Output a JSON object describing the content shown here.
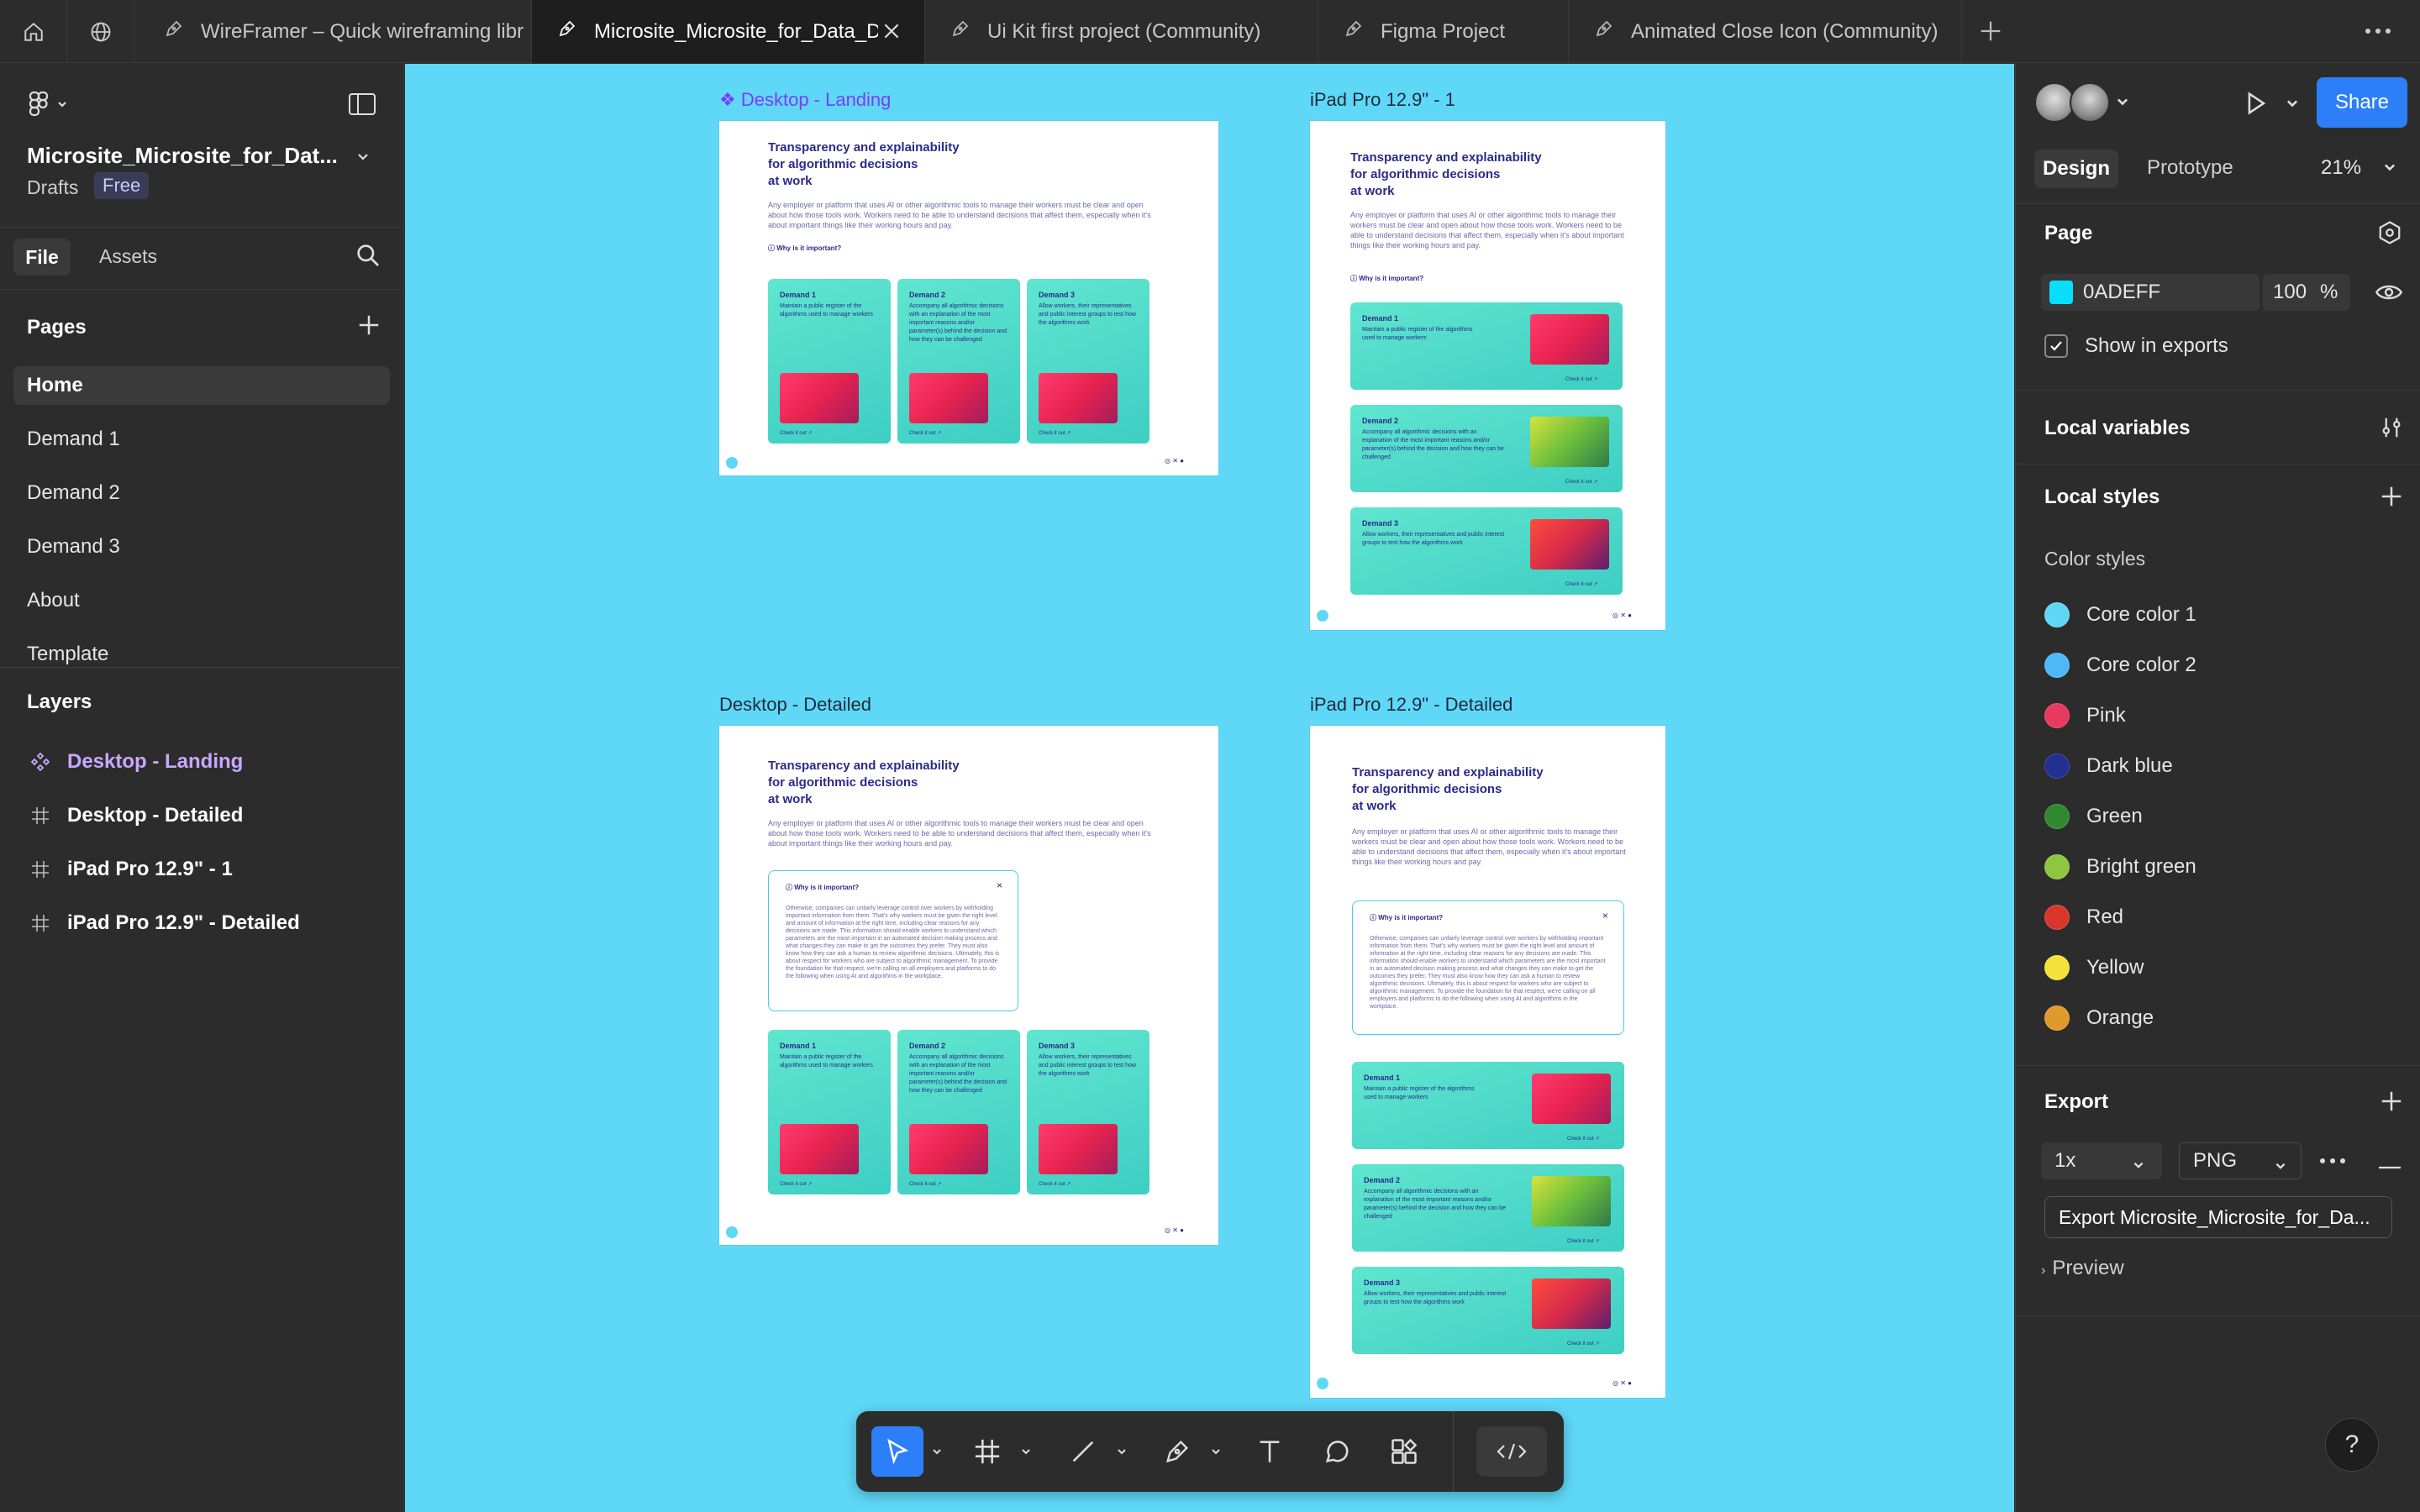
{
  "tabs": [
    {
      "label": "WireFramer – Quick wireframing libr",
      "active": false
    },
    {
      "label": "Microsite_Microsite_for_Data_D",
      "active": true
    },
    {
      "label": "Ui Kit first project (Community)",
      "active": false
    },
    {
      "label": "Figma Project",
      "active": false
    },
    {
      "label": "Animated Close Icon (Community)",
      "active": false
    }
  ],
  "left": {
    "file_name": "Microsite_Microsite_for_Dat...",
    "location": "Drafts",
    "plan_badge": "Free",
    "tab_file": "File",
    "tab_assets": "Assets",
    "pages_heading": "Pages",
    "pages": [
      "Home",
      "Demand 1",
      "Demand 2",
      "Demand 3",
      "About",
      "Template"
    ],
    "layers_heading": "Layers",
    "layers": [
      {
        "label": "Desktop - Landing",
        "type": "component"
      },
      {
        "label": "Desktop - Detailed",
        "type": "frame"
      },
      {
        "label": "iPad Pro 12.9\" - 1",
        "type": "frame"
      },
      {
        "label": "iPad Pro 12.9\" - Detailed",
        "type": "frame"
      }
    ]
  },
  "canvas": {
    "background": "#5fd8f8",
    "frames": [
      {
        "label": "Desktop - Landing",
        "component": true
      },
      {
        "label": "iPad Pro 12.9\" - 1",
        "component": false
      },
      {
        "label": "Desktop - Detailed",
        "component": false
      },
      {
        "label": "iPad Pro 12.9\" - Detailed",
        "component": false
      }
    ],
    "content": {
      "title_line1": "Transparency and explainability",
      "title_line2": "for algorithmic decisions",
      "title_line3": "at work",
      "intro": "Any employer or platform that uses AI or other algorithmic tools to manage their workers must be clear and open about how those tools work. Workers need to be able to understand decisions that affect them, especially when it's about important things like their working hours and pay.",
      "why": "Why is it important?",
      "why_body": "Otherwise, companies can unfairly leverage control over workers by withholding important information from them. That's why workers must be given the right level and amount of information at the right time, including clear reasons for any decisions are made. This information should enable workers to understand which parameters are the most important in an automated decision making process and what changes they can make to get the outcomes they prefer. They must also know how they can ask a human to review algorithmic decisions. Ultimately, this is about respect for workers who are subject to algorithmic management. To provide the foundation for that respect, we're calling on all employers and platforms to do the following when using AI and algorithms in the workplace.",
      "demand1_title": "Demand 1",
      "demand1_body": "Maintain a public register of the algorithms used to manage workers",
      "demand2_title": "Demand 2",
      "demand2_body": "Accompany all algorithmic decisions with an explanation of the most important reasons and/or parameter(s) behind the decision and how they can be challenged",
      "demand3_title": "Demand 3",
      "demand3_body": "Allow workers, their representatives and public interest groups to test how the algorithms work",
      "check": "Check it out ↗"
    }
  },
  "right": {
    "tab_design": "Design",
    "tab_prototype": "Prototype",
    "zoom": "21%",
    "share_label": "Share",
    "page_heading": "Page",
    "page_color": "0ADEFF",
    "page_color_swatch": "#0ADEFF",
    "page_opacity": "100",
    "percent_sign": "%",
    "show_in_exports": "Show in exports",
    "local_variables": "Local variables",
    "local_styles": "Local styles",
    "color_styles_heading": "Color styles",
    "color_styles": [
      {
        "name": "Core color 1",
        "color": "#5fd8f8"
      },
      {
        "name": "Core color 2",
        "color": "#4cb8f5"
      },
      {
        "name": "Pink",
        "color": "#e8395f"
      },
      {
        "name": "Dark blue",
        "color": "#23308f"
      },
      {
        "name": "Green",
        "color": "#2f8a2f"
      },
      {
        "name": "Bright green",
        "color": "#8dc63f"
      },
      {
        "name": "Red",
        "color": "#d9362b"
      },
      {
        "name": "Yellow",
        "color": "#f4e23a"
      },
      {
        "name": "Orange",
        "color": "#e09a2c"
      }
    ],
    "export_heading": "Export",
    "export_scale": "1x",
    "export_format": "PNG",
    "export_button": "Export Microsite_Microsite_for_Da...",
    "preview": "Preview"
  }
}
